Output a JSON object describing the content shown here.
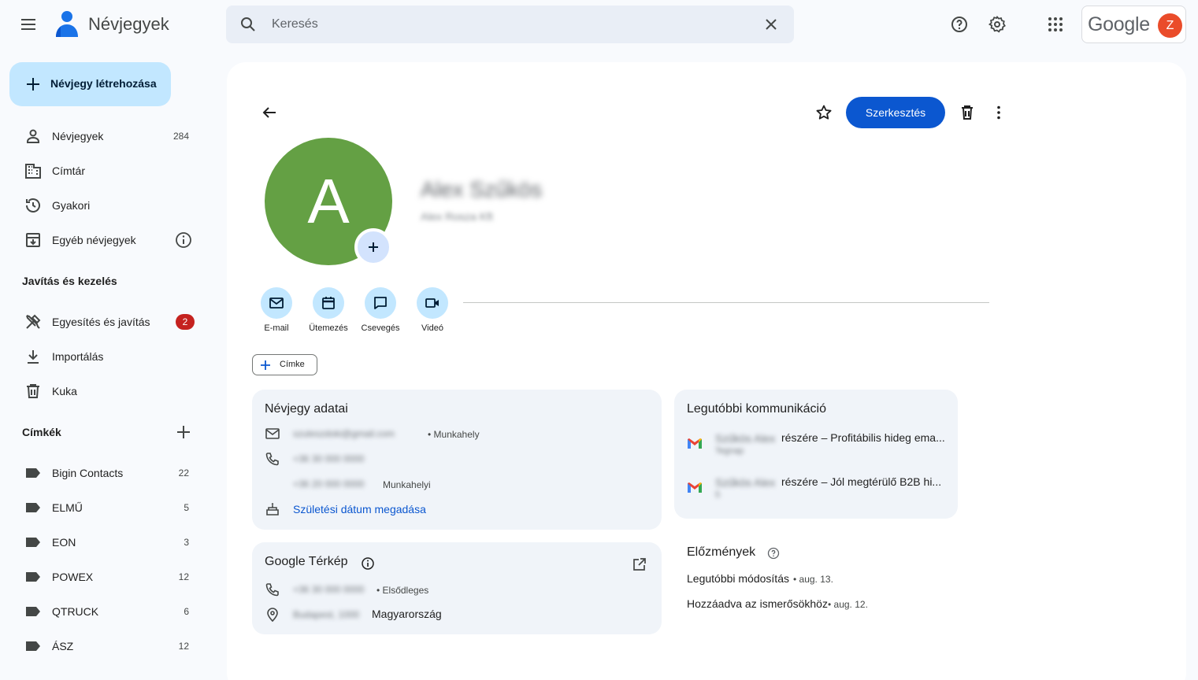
{
  "app": {
    "title": "Névjegyek"
  },
  "search": {
    "placeholder": "Keresés"
  },
  "account": {
    "brand": "Google",
    "initial": "Z"
  },
  "sidebar": {
    "create_label": "Névjegy létrehozása",
    "items": [
      {
        "label": "Névjegyek",
        "count": "284"
      },
      {
        "label": "Címtár"
      },
      {
        "label": "Gyakori"
      },
      {
        "label": "Egyéb névjegyek"
      }
    ],
    "fix_section": "Javítás és kezelés",
    "fix_items": [
      {
        "label": "Egyesítés és javítás",
        "badge": "2"
      },
      {
        "label": "Importálás"
      },
      {
        "label": "Kuka"
      }
    ],
    "labels_section": "Címkék",
    "labels": [
      {
        "label": "Bigin Contacts",
        "count": "22"
      },
      {
        "label": "ELMŰ",
        "count": "5"
      },
      {
        "label": "EON",
        "count": "3"
      },
      {
        "label": "POWEX",
        "count": "12"
      },
      {
        "label": "QTRUCK",
        "count": "6"
      },
      {
        "label": "ÁSZ",
        "count": "12"
      }
    ]
  },
  "contact": {
    "initial": "A",
    "avatar_color": "#64a044",
    "name": "Alex Szűkös",
    "subtitle": "Alex Rosza Kft",
    "edit_label": "Szerkesztés",
    "actions": [
      "E-mail",
      "Ütemezés",
      "Csevegés",
      "Videó"
    ],
    "label_button": "Címke"
  },
  "details": {
    "title": "Névjegy adatai",
    "email": "szuleszdoki@gmail.com",
    "email_type": "• Munkahely",
    "phone1": "+36 30 000 0000",
    "phone2": "+36 20 000 0000",
    "phone2_type": "Munkahelyi",
    "birthday_link": "Születési dátum megadása"
  },
  "maps": {
    "title": "Google Térkép",
    "phone": "+36 30 000 0000",
    "phone_type": "• Elsődleges",
    "address_blur": "Budapest, 1000",
    "country": "Magyarország"
  },
  "recent": {
    "title": "Legutóbbi kommunikáció",
    "items": [
      {
        "blur": "Szűkös Alex ",
        "text": "részére – Profitábilis hideg ema...",
        "sub": "Tegnap"
      },
      {
        "blur": "Szűkös Alex ",
        "text": "részére – Jól megtérülő B2B hi...",
        "sub": "5"
      }
    ]
  },
  "history": {
    "title": "Előzmények",
    "modified_label": "Legutóbbi módosítás",
    "modified_date": "• aug. 13.",
    "added_label": "Hozzáadva az ismerősökhöz",
    "added_date": "• aug. 12."
  }
}
